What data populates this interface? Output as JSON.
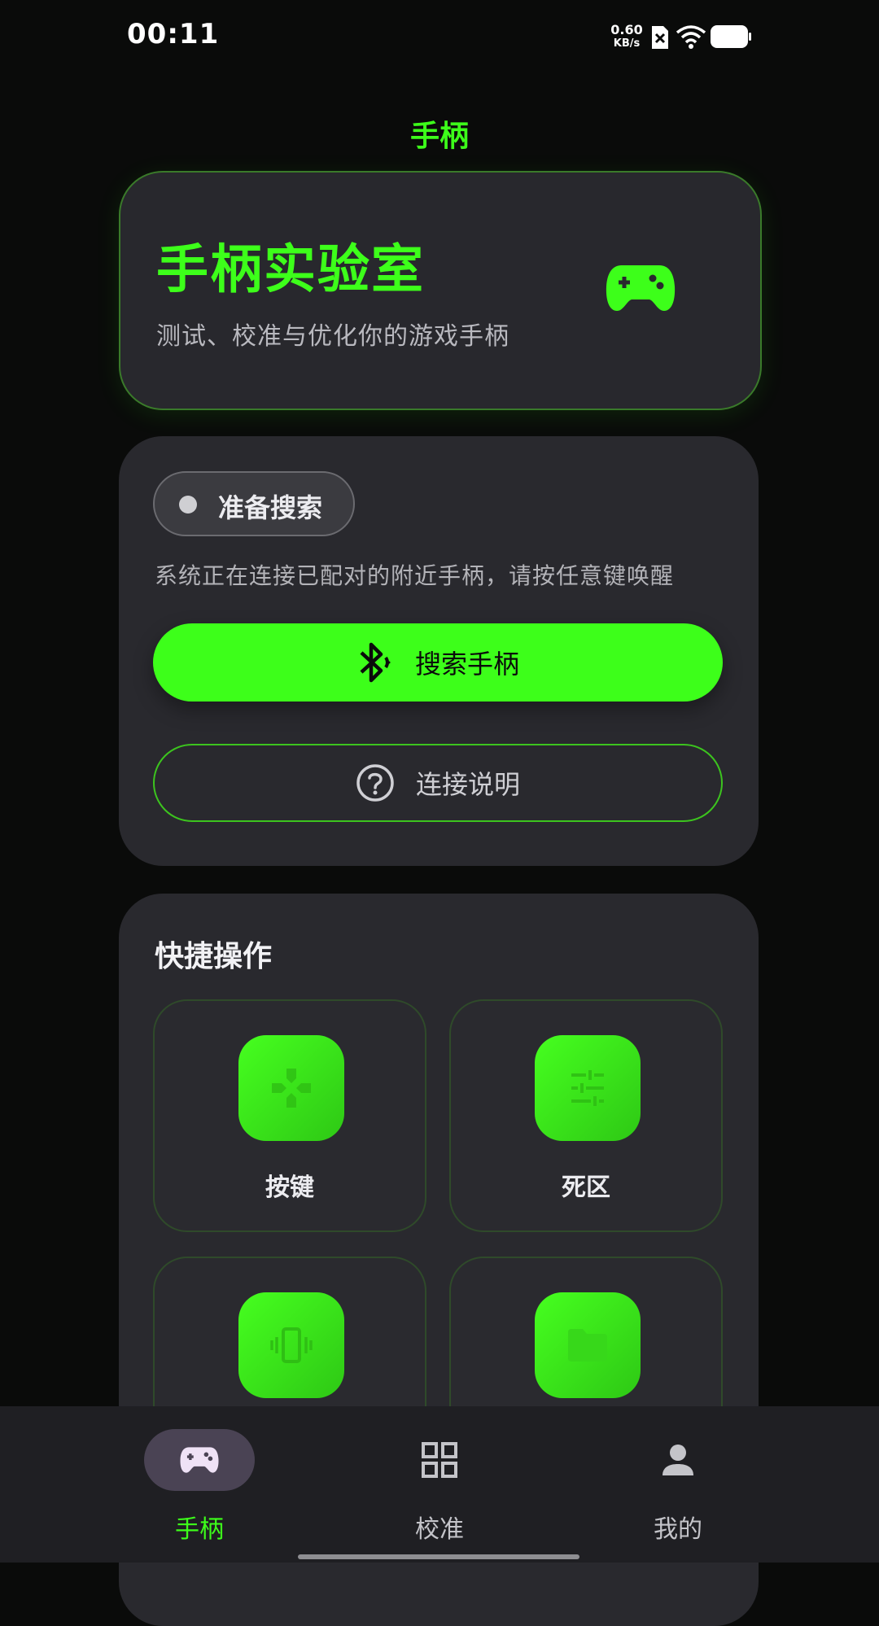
{
  "status_bar": {
    "time": "00:11",
    "net_speed_value": "0.60",
    "net_speed_unit": "KB/s"
  },
  "topbar": {
    "title": "手柄"
  },
  "hero": {
    "title": "手柄实验室",
    "subtitle": "测试、校准与优化你的游戏手柄",
    "icon": "gamepad-icon"
  },
  "connection": {
    "status_label": "准备搜索",
    "description": "系统正在连接已配对的附近手柄，请按任意键唤醒",
    "search_button": {
      "label": "搜索手柄",
      "icon": "bluetooth-searching-icon"
    },
    "help_button": {
      "label": "连接说明",
      "icon": "help-circle-icon"
    }
  },
  "quick_actions": {
    "title": "快捷操作",
    "items": [
      {
        "label": "按键",
        "icon": "dpad-icon"
      },
      {
        "label": "死区",
        "icon": "sliders-icon"
      },
      {
        "label": "",
        "icon": "vibration-icon"
      },
      {
        "label": "",
        "icon": "folder-icon"
      }
    ]
  },
  "bottom_nav": {
    "items": [
      {
        "label": "手柄",
        "icon": "gamepad-icon",
        "active": true
      },
      {
        "label": "校准",
        "icon": "grid-icon",
        "active": false
      },
      {
        "label": "我的",
        "icon": "person-icon",
        "active": false
      }
    ]
  },
  "colors": {
    "accent": "#3dff1a",
    "background": "#0a0b0a",
    "card": "#29292e",
    "nav_background": "#1f1f23",
    "active_pill": "#4a4354"
  }
}
